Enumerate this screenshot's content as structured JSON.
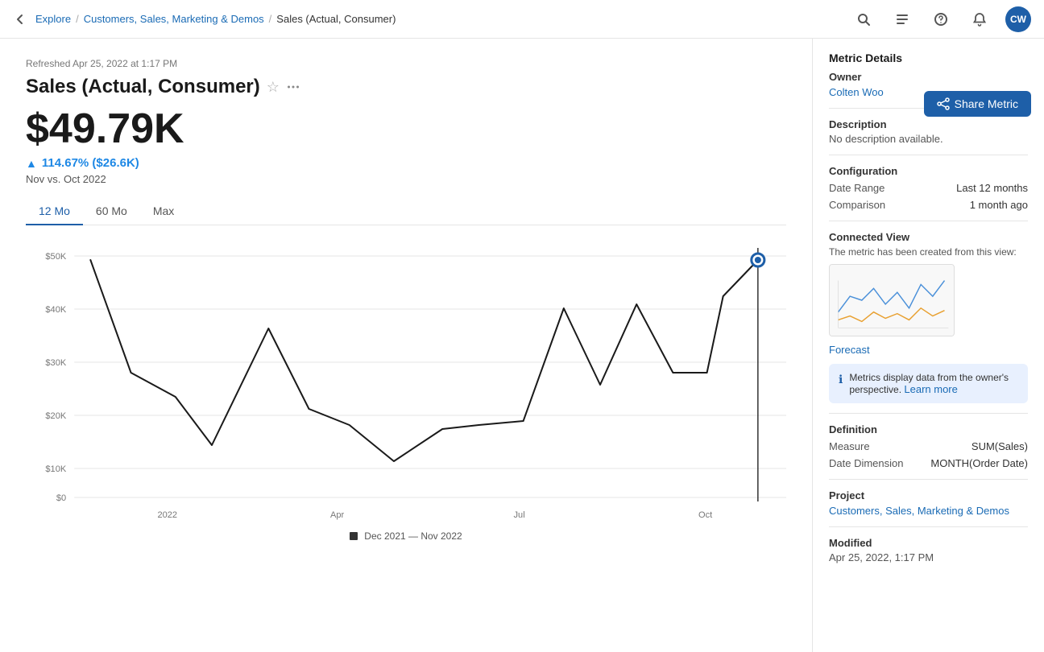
{
  "topnav": {
    "back_icon": "←",
    "breadcrumbs": [
      "Explore",
      "Customers, Sales, Marketing & Demos",
      "Sales (Actual, Consumer)"
    ],
    "nav_icons": [
      "search",
      "edit",
      "help",
      "bell"
    ],
    "avatar_initials": "CW"
  },
  "header": {
    "refresh_text": "Refreshed Apr 25, 2022 at 1:17 PM",
    "title": "Sales (Actual, Consumer)",
    "big_value": "$49.79K",
    "change": "114.67% ($26.6K)",
    "comparison": "Nov vs. Oct 2022"
  },
  "share_button": "Share Metric",
  "tabs": [
    {
      "label": "12 Mo",
      "active": true
    },
    {
      "label": "60 Mo",
      "active": false
    },
    {
      "label": "Max",
      "active": false
    }
  ],
  "chart": {
    "y_labels": [
      "$50K",
      "$40K",
      "$30K",
      "$20K",
      "$10K",
      "$0"
    ],
    "x_labels": [
      "2022",
      "Apr",
      "Jul",
      "Oct"
    ],
    "legend_text": "Dec 2021 — Nov 2022"
  },
  "sidebar": {
    "metric_details_title": "Metric Details",
    "owner_label": "Owner",
    "owner_value": "Colten Woo",
    "description_title": "Description",
    "description_text": "No description available.",
    "configuration_title": "Configuration",
    "date_range_label": "Date Range",
    "date_range_value": "Last 12 months",
    "comparison_label": "Comparison",
    "comparison_value": "1 month ago",
    "connected_view_title": "Connected View",
    "connected_view_desc": "The metric has been created from this view:",
    "forecast_label": "Forecast",
    "info_box_text": "Metrics display data from the owner's perspective.",
    "learn_more": "Learn more",
    "definition_title": "Definition",
    "measure_label": "Measure",
    "measure_value": "SUM(Sales)",
    "date_dimension_label": "Date Dimension",
    "date_dimension_value": "MONTH(Order Date)",
    "project_title": "Project",
    "project_value": "Customers, Sales, Marketing & Demos",
    "modified_title": "Modified",
    "modified_value": "Apr 25, 2022, 1:17 PM"
  }
}
